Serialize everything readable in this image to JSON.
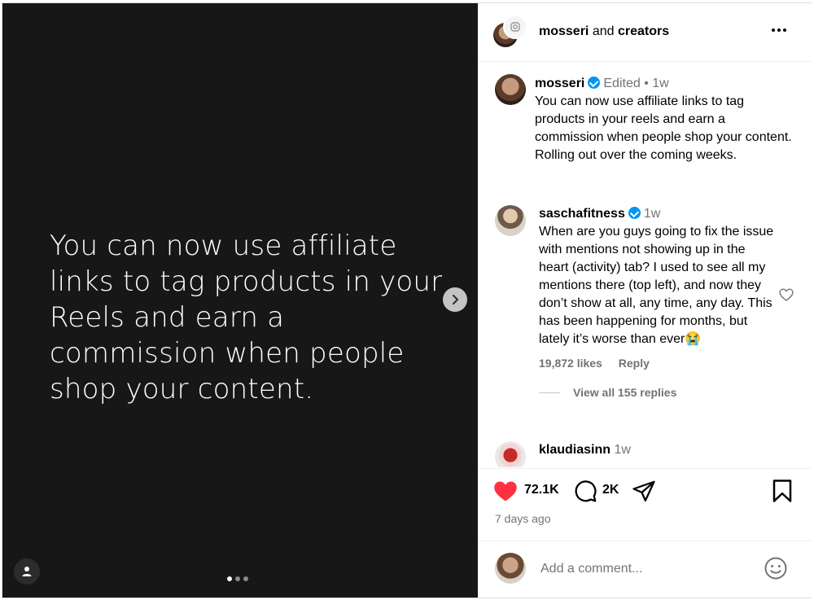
{
  "media": {
    "text": "You can now use affiliate links to tag products in your Reels and earn a commission when people shop your content.",
    "slide_count": 3,
    "active_slide": 1
  },
  "header": {
    "author": "mosseri",
    "joiner": "and",
    "coauthor": "creators",
    "more_icon": "more-horizontal-icon"
  },
  "caption": {
    "username": "mosseri",
    "edited": "Edited",
    "separator": "•",
    "time": "1w",
    "text": "You can now use affiliate links to tag products in your reels and earn a commission when people shop your content. Rolling out over the coming weeks."
  },
  "comments": [
    {
      "username": "saschafitness",
      "time": "1w",
      "text": "When are you guys going to fix the issue with mentions not showing up in the heart (activity) tab? I used to see all my mentions there (top left), and now they don’t show at all, any time, any day. This has been happening for months, but lately it’s worse than ever😭",
      "likes": "19,872 likes",
      "reply": "Reply",
      "view_replies": "View all 155 replies"
    },
    {
      "username": "klaudiasinn",
      "time": "1w"
    }
  ],
  "actions": {
    "likes": "72.1K",
    "comments": "2K",
    "timestamp": "7 days ago"
  },
  "composer": {
    "placeholder": "Add a comment..."
  },
  "colors": {
    "like_red": "#ff3040",
    "verified_blue": "#0095f6",
    "media_bg": "#171717"
  }
}
